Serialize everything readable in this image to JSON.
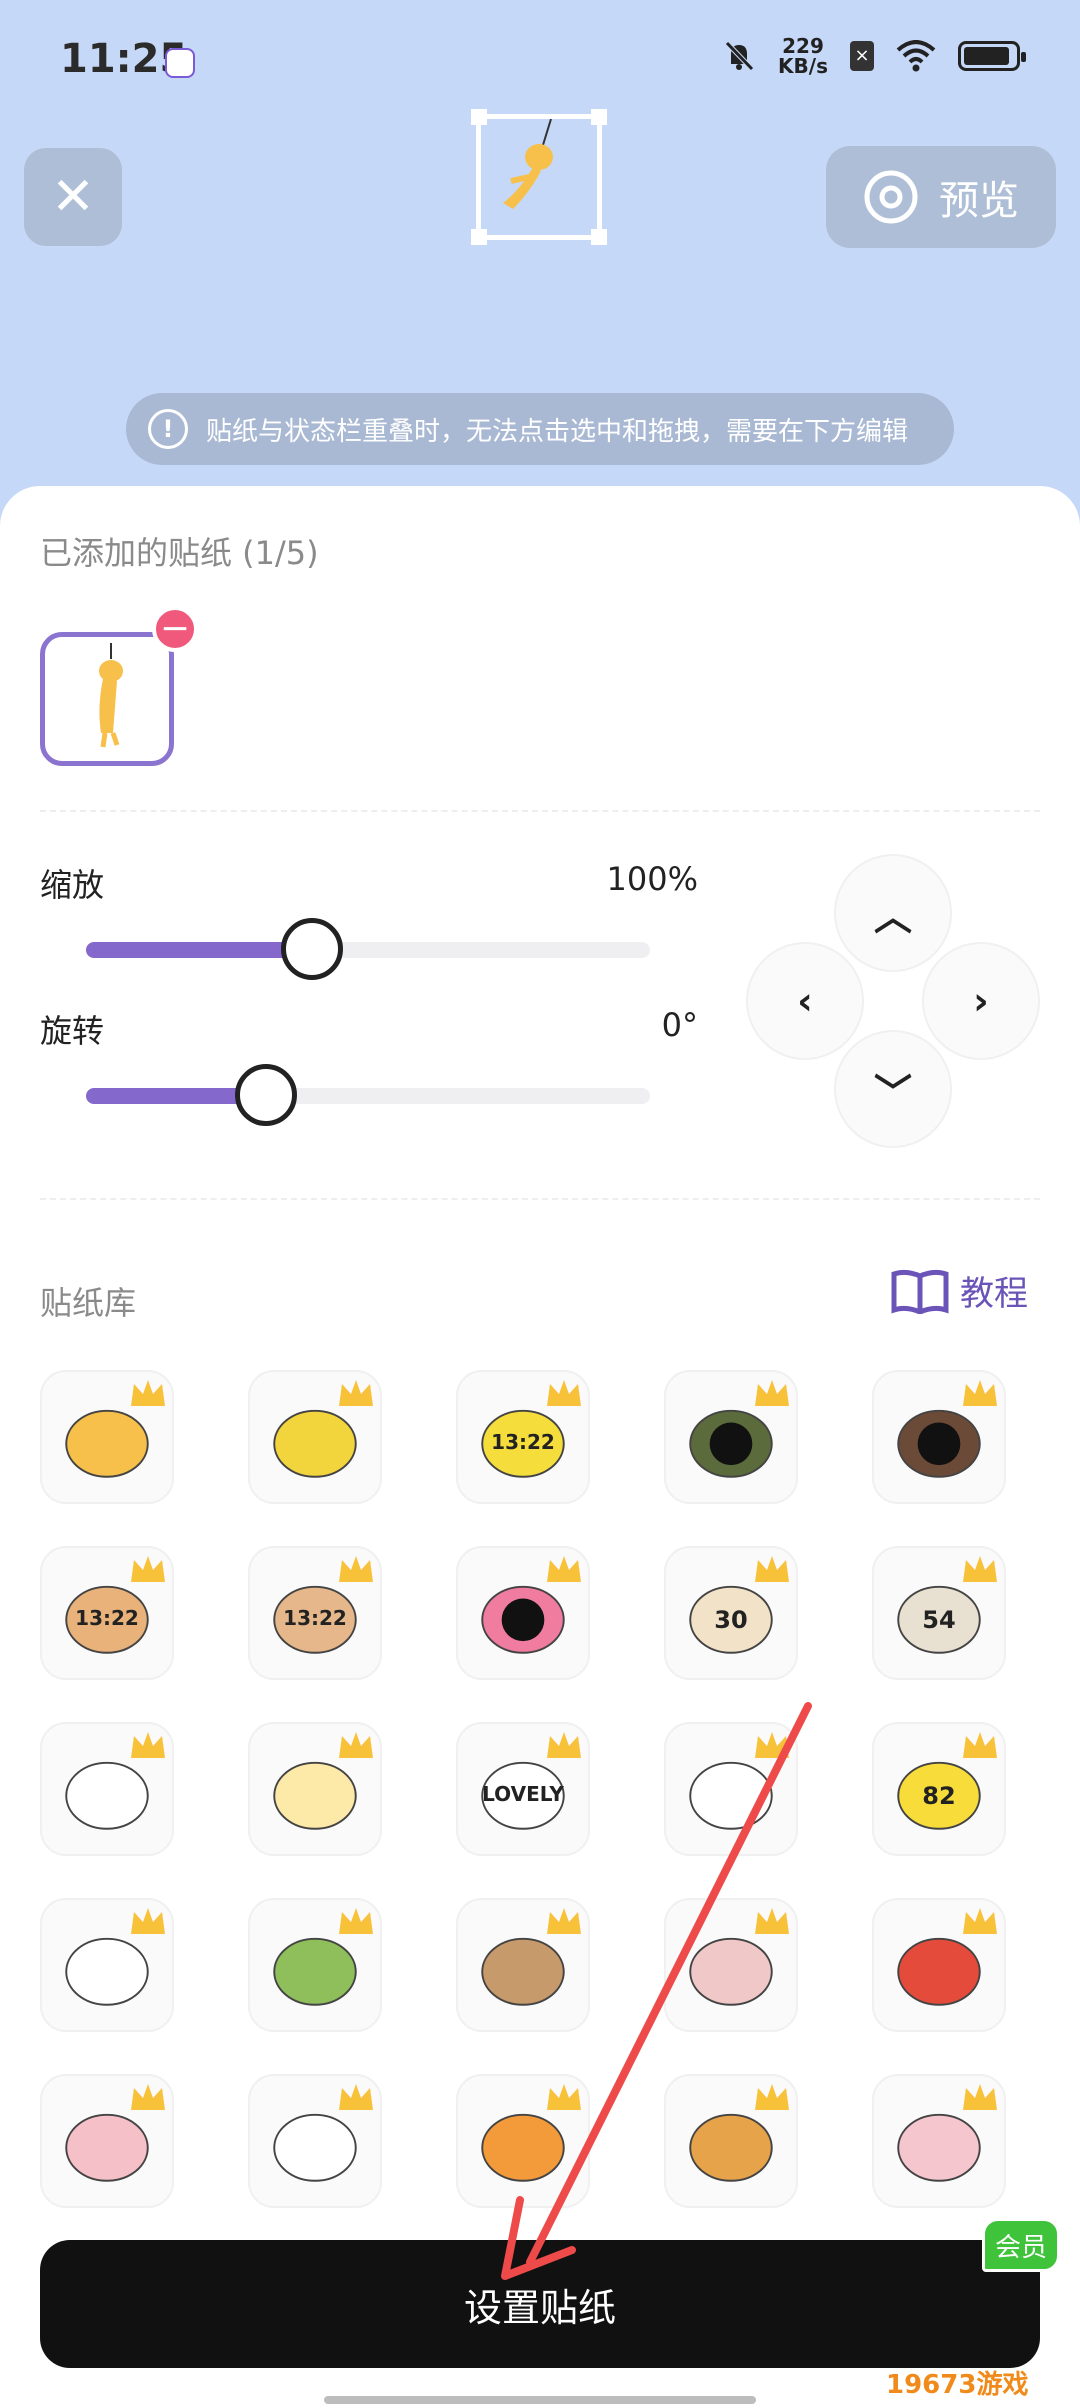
{
  "status": {
    "time": "11:25",
    "net_speed_value": "229",
    "net_speed_unit": "KB/s",
    "battery_level": 0.9,
    "sim_label": "×"
  },
  "top": {
    "close_icon": "close-icon",
    "preview_label": "预览",
    "notice": "贴纸与状态栏重叠时，无法点击选中和拖拽，需要在下方编辑"
  },
  "added": {
    "title": "已添加的贴纸 (1/5)"
  },
  "controls": {
    "scale_label": "缩放",
    "scale_value": "100%",
    "scale_fraction": 0.4,
    "rotate_label": "旋转",
    "rotate_value": "0°",
    "rotate_fraction": 0.32
  },
  "library": {
    "title": "贴纸库",
    "tutorial_label": "教程",
    "items": [
      {
        "name": "sticker-hanging-cat",
        "text": ""
      },
      {
        "name": "sticker-minion",
        "text": ""
      },
      {
        "name": "sticker-duck-clock",
        "text": "13:22"
      },
      {
        "name": "sticker-turtle",
        "text": ""
      },
      {
        "name": "sticker-bear",
        "text": ""
      },
      {
        "name": "sticker-carrot-clock",
        "text": "13:22"
      },
      {
        "name": "sticker-cookie-clock",
        "text": "13:22"
      },
      {
        "name": "sticker-flower",
        "text": ""
      },
      {
        "name": "sticker-cat-battery",
        "text": "30"
      },
      {
        "name": "sticker-bunnies-battery",
        "text": "54"
      },
      {
        "name": "sticker-polar-bear",
        "text": ""
      },
      {
        "name": "sticker-daisy",
        "text": ""
      },
      {
        "name": "sticker-lovely",
        "text": "LOVELY"
      },
      {
        "name": "sticker-small-animals",
        "text": ""
      },
      {
        "name": "sticker-tulip-battery",
        "text": "82"
      },
      {
        "name": "sticker-cloud",
        "text": ""
      },
      {
        "name": "sticker-avocado",
        "text": ""
      },
      {
        "name": "sticker-swing-bears",
        "text": ""
      },
      {
        "name": "sticker-lion",
        "text": ""
      },
      {
        "name": "sticker-firecracker",
        "text": ""
      },
      {
        "name": "sticker-pig",
        "text": ""
      },
      {
        "name": "sticker-panda",
        "text": ""
      },
      {
        "name": "sticker-carrot-cat",
        "text": ""
      },
      {
        "name": "sticker-swing-cat",
        "text": ""
      },
      {
        "name": "sticker-hanging-bunny",
        "text": ""
      }
    ]
  },
  "footer": {
    "set_label": "设置贴纸",
    "vip_label": "会员",
    "watermark": "19673游戏"
  },
  "colors": {
    "accent": "#8468cc",
    "header_bg": "#c6d8f7",
    "remove": "#f0597b",
    "vip": "#3fc33a"
  }
}
